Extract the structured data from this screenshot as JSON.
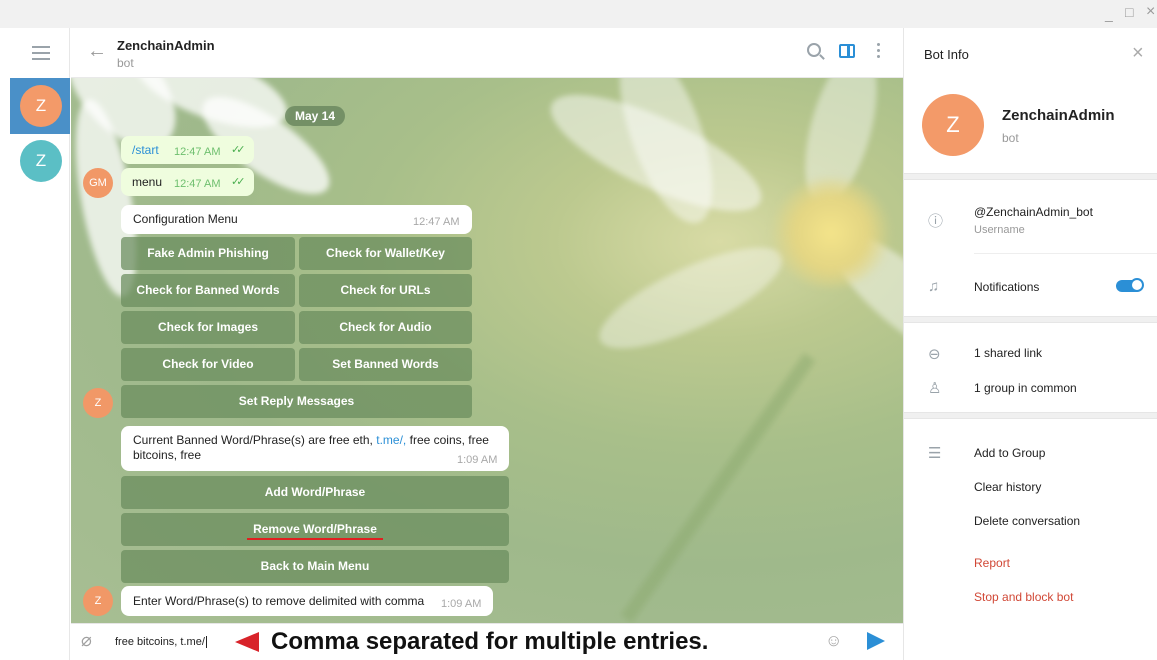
{
  "window": {
    "minimize": "_",
    "maximize": "□",
    "close": "×"
  },
  "sidebar": {
    "chats": [
      {
        "initial": "Z",
        "color": "#f39a69"
      },
      {
        "initial": "Z",
        "color": "#5bbfc5"
      }
    ]
  },
  "header": {
    "title": "ZenchainAdmin",
    "subtitle": "bot"
  },
  "chat": {
    "date_pill": "May 14",
    "messages": [
      {
        "text": "/start",
        "time": "12:47 AM"
      },
      {
        "text": "menu",
        "time": "12:47 AM"
      }
    ],
    "user_avatar": "GM",
    "bot_avatar": "Z",
    "config_menu": {
      "text": "Configuration Menu",
      "time": "12:47 AM"
    },
    "menu_buttons": [
      "Fake Admin Phishing",
      "Check for Wallet/Key",
      "Check for Banned Words",
      "Check for URLs",
      "Check for Images",
      "Check for Audio",
      "Check for Video",
      "Set Banned Words",
      "Set Reply Messages"
    ],
    "banned_msg": {
      "prefix": "Current Banned Word/Phrase(s) are free eth,",
      "link": "t.me/,",
      "rest1": "free coins,  free",
      "rest2": "bitcoins,  free",
      "time": "1:09 AM"
    },
    "word_buttons": [
      "Add Word/Phrase",
      "Remove Word/Phrase",
      "Back to Main Menu"
    ],
    "prompt_msg": {
      "text": "Enter Word/Phrase(s) to remove delimited with comma",
      "time": "1:09 AM"
    }
  },
  "compose": {
    "value": "free bitcoins, t.me/",
    "annotation": "Comma separated for multiple entries."
  },
  "bot_info": {
    "title": "Bot Info",
    "avatar_initial": "Z",
    "name": "ZenchainAdmin",
    "subtitle": "bot",
    "username": "@ZenchainAdmin_bot",
    "username_label": "Username",
    "notifications": "Notifications",
    "notifications_on": true,
    "shared_links": "1 shared link",
    "groups_common": "1 group in common",
    "add_to_group": "Add to Group",
    "clear_history": "Clear history",
    "delete_conversation": "Delete conversation",
    "report": "Report",
    "stop_block": "Stop and block bot"
  }
}
